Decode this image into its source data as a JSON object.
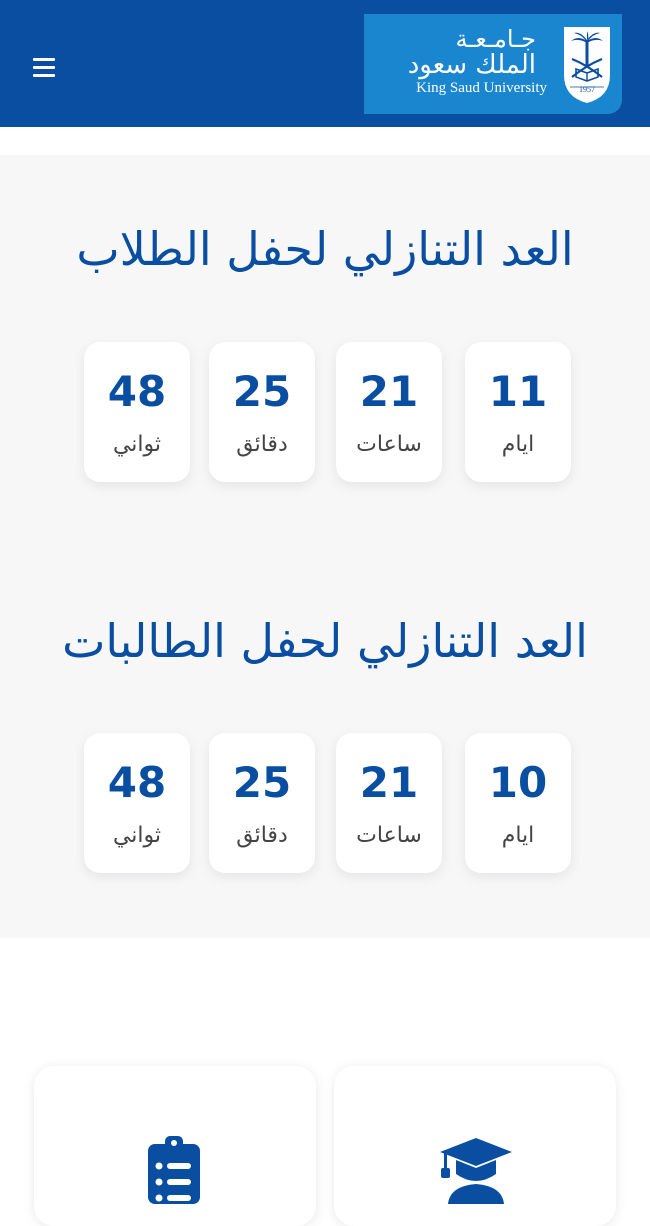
{
  "header": {
    "logo_ar_line1": "جـامـعـة",
    "logo_ar_line2": "الملك سعود",
    "logo_en": "King Saud University",
    "seal_year": "1957"
  },
  "countdown_male": {
    "title": "العد التنازلي لحفل الطلاب",
    "units": [
      {
        "value": "11",
        "label": "ايام"
      },
      {
        "value": "21",
        "label": "ساعات"
      },
      {
        "value": "25",
        "label": "دقائق"
      },
      {
        "value": "48",
        "label": "ثواني"
      }
    ]
  },
  "countdown_female": {
    "title": "العد التنازلي لحفل الطالبات",
    "units": [
      {
        "value": "10",
        "label": "ايام"
      },
      {
        "value": "21",
        "label": "ساعات"
      },
      {
        "value": "25",
        "label": "دقائق"
      },
      {
        "value": "48",
        "label": "ثواني"
      }
    ]
  },
  "colors": {
    "brand_blue": "#0a4ea1",
    "logo_blue": "#1b86d0",
    "panel_bg": "#f7f7f8"
  },
  "icons": {
    "menu": "hamburger-menu-icon",
    "left_feature": "clipboard-checklist-icon",
    "right_feature": "graduate-icon"
  }
}
